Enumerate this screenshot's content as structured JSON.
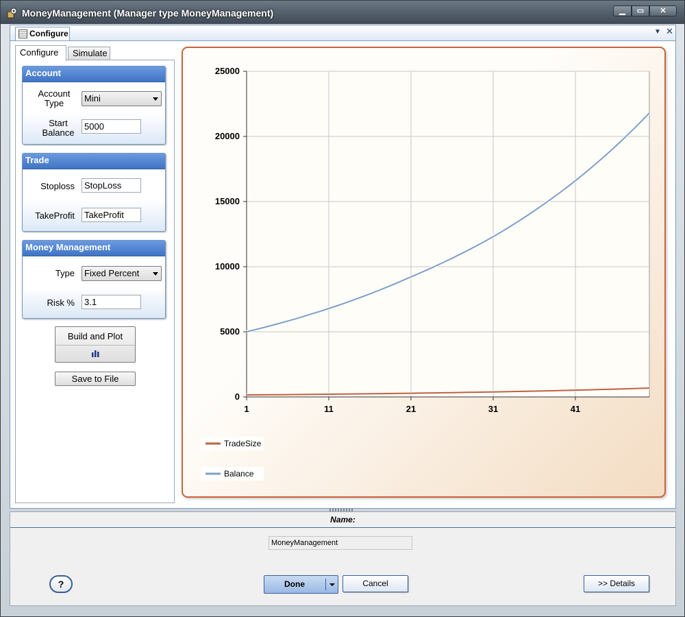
{
  "window": {
    "title": "MoneyManagement (Manager type MoneyManagement)"
  },
  "document_tab": {
    "label": "Configure"
  },
  "inner_tabs": [
    {
      "label": "Configure"
    },
    {
      "label": "Simulate"
    }
  ],
  "account": {
    "header": "Account",
    "account_type_label": "Account Type",
    "account_type_value": "Mini",
    "start_balance_label": "Start Balance",
    "start_balance_value": "5000"
  },
  "trade": {
    "header": "Trade",
    "stoploss_label": "Stoploss",
    "stoploss_value": "StopLoss",
    "takeprofit_label": "TakeProfit",
    "takeprofit_value": "TakeProfit"
  },
  "money_management": {
    "header": "Money Management",
    "type_label": "Type",
    "type_value": "Fixed Percent",
    "risk_label": "Risk %",
    "risk_value": "3.1"
  },
  "buttons": {
    "build_plot": "Build and Plot",
    "save_file": "Save to File"
  },
  "chart_data": {
    "type": "line",
    "title": "",
    "xlabel": "",
    "ylabel": "",
    "xlim": [
      1,
      50
    ],
    "ylim": [
      0,
      25000
    ],
    "x_ticks": [
      "1",
      "11",
      "21",
      "31",
      "41"
    ],
    "y_ticks": [
      "0",
      "5000",
      "10000",
      "15000",
      "20000",
      "25000"
    ],
    "grid": true,
    "legend_position": "bottom-left",
    "series": [
      {
        "name": "TradeSize",
        "color": "#c0603c",
        "x": [
          1,
          11,
          21,
          31,
          41,
          50
        ],
        "values": [
          155,
          210,
          285,
          385,
          520,
          680
        ]
      },
      {
        "name": "Balance",
        "color": "#7e9ec8",
        "x": [
          1,
          11,
          21,
          31,
          41,
          50
        ],
        "values": [
          5000,
          6790,
          9220,
          12300,
          16600,
          21800
        ]
      }
    ]
  },
  "bottom": {
    "name_label": "Name:",
    "name_value": "MoneyManagement",
    "help": "?",
    "done": "Done",
    "cancel": "Cancel",
    "details": ">> Details"
  }
}
